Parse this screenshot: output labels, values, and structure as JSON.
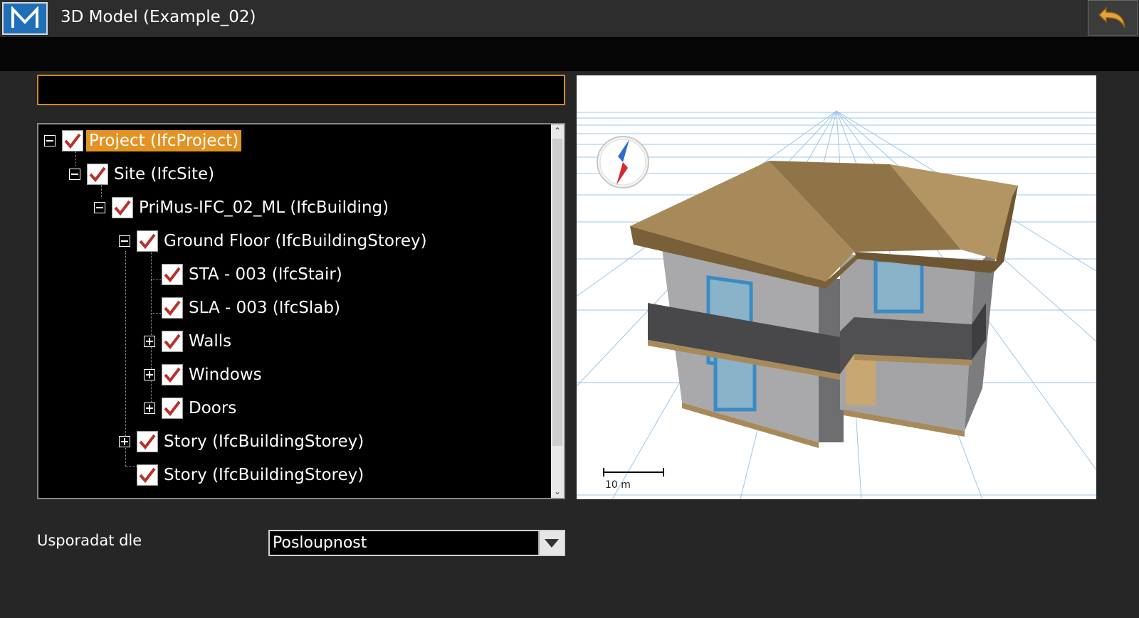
{
  "window": {
    "title": "3D Model (Example_02)",
    "logo_letter": "M"
  },
  "search": {
    "value": "",
    "placeholder": ""
  },
  "tree": {
    "nodes": [
      {
        "label": "Project (IfcProject)",
        "expander": "minus",
        "checked": true,
        "selected": true
      },
      {
        "label": "Site (IfcSite)",
        "expander": "minus",
        "checked": true,
        "selected": false
      },
      {
        "label": "PriMus-IFC_02_ML (IfcBuilding)",
        "expander": "minus",
        "checked": true,
        "selected": false
      },
      {
        "label": "Ground Floor (IfcBuildingStorey)",
        "expander": "minus",
        "checked": true,
        "selected": false
      },
      {
        "label": "STA - 003 (IfcStair)",
        "expander": "none",
        "checked": true,
        "selected": false
      },
      {
        "label": "SLA - 003 (IfcSlab)",
        "expander": "none",
        "checked": true,
        "selected": false
      },
      {
        "label": "Walls",
        "expander": "plus",
        "checked": true,
        "selected": false
      },
      {
        "label": "Windows",
        "expander": "plus",
        "checked": true,
        "selected": false
      },
      {
        "label": "Doors",
        "expander": "plus",
        "checked": true,
        "selected": false
      },
      {
        "label": "Story (IfcBuildingStorey)",
        "expander": "plus",
        "checked": true,
        "selected": false
      },
      {
        "label": "Story (IfcBuildingStorey)",
        "expander": "none",
        "checked": true,
        "selected": false
      }
    ]
  },
  "viewer": {
    "scale_label": "10 m"
  },
  "sort": {
    "label": "Usporadat dle",
    "selected": "Posloupnost"
  },
  "colors": {
    "accent": "#e29323",
    "logo_bg": "#1f6fb8",
    "check": "#b8312a",
    "roof": "#a88a5a",
    "wall": "#a8a8aa",
    "balcony": "#4a4a4c",
    "window_frame": "#3a8bc4"
  }
}
